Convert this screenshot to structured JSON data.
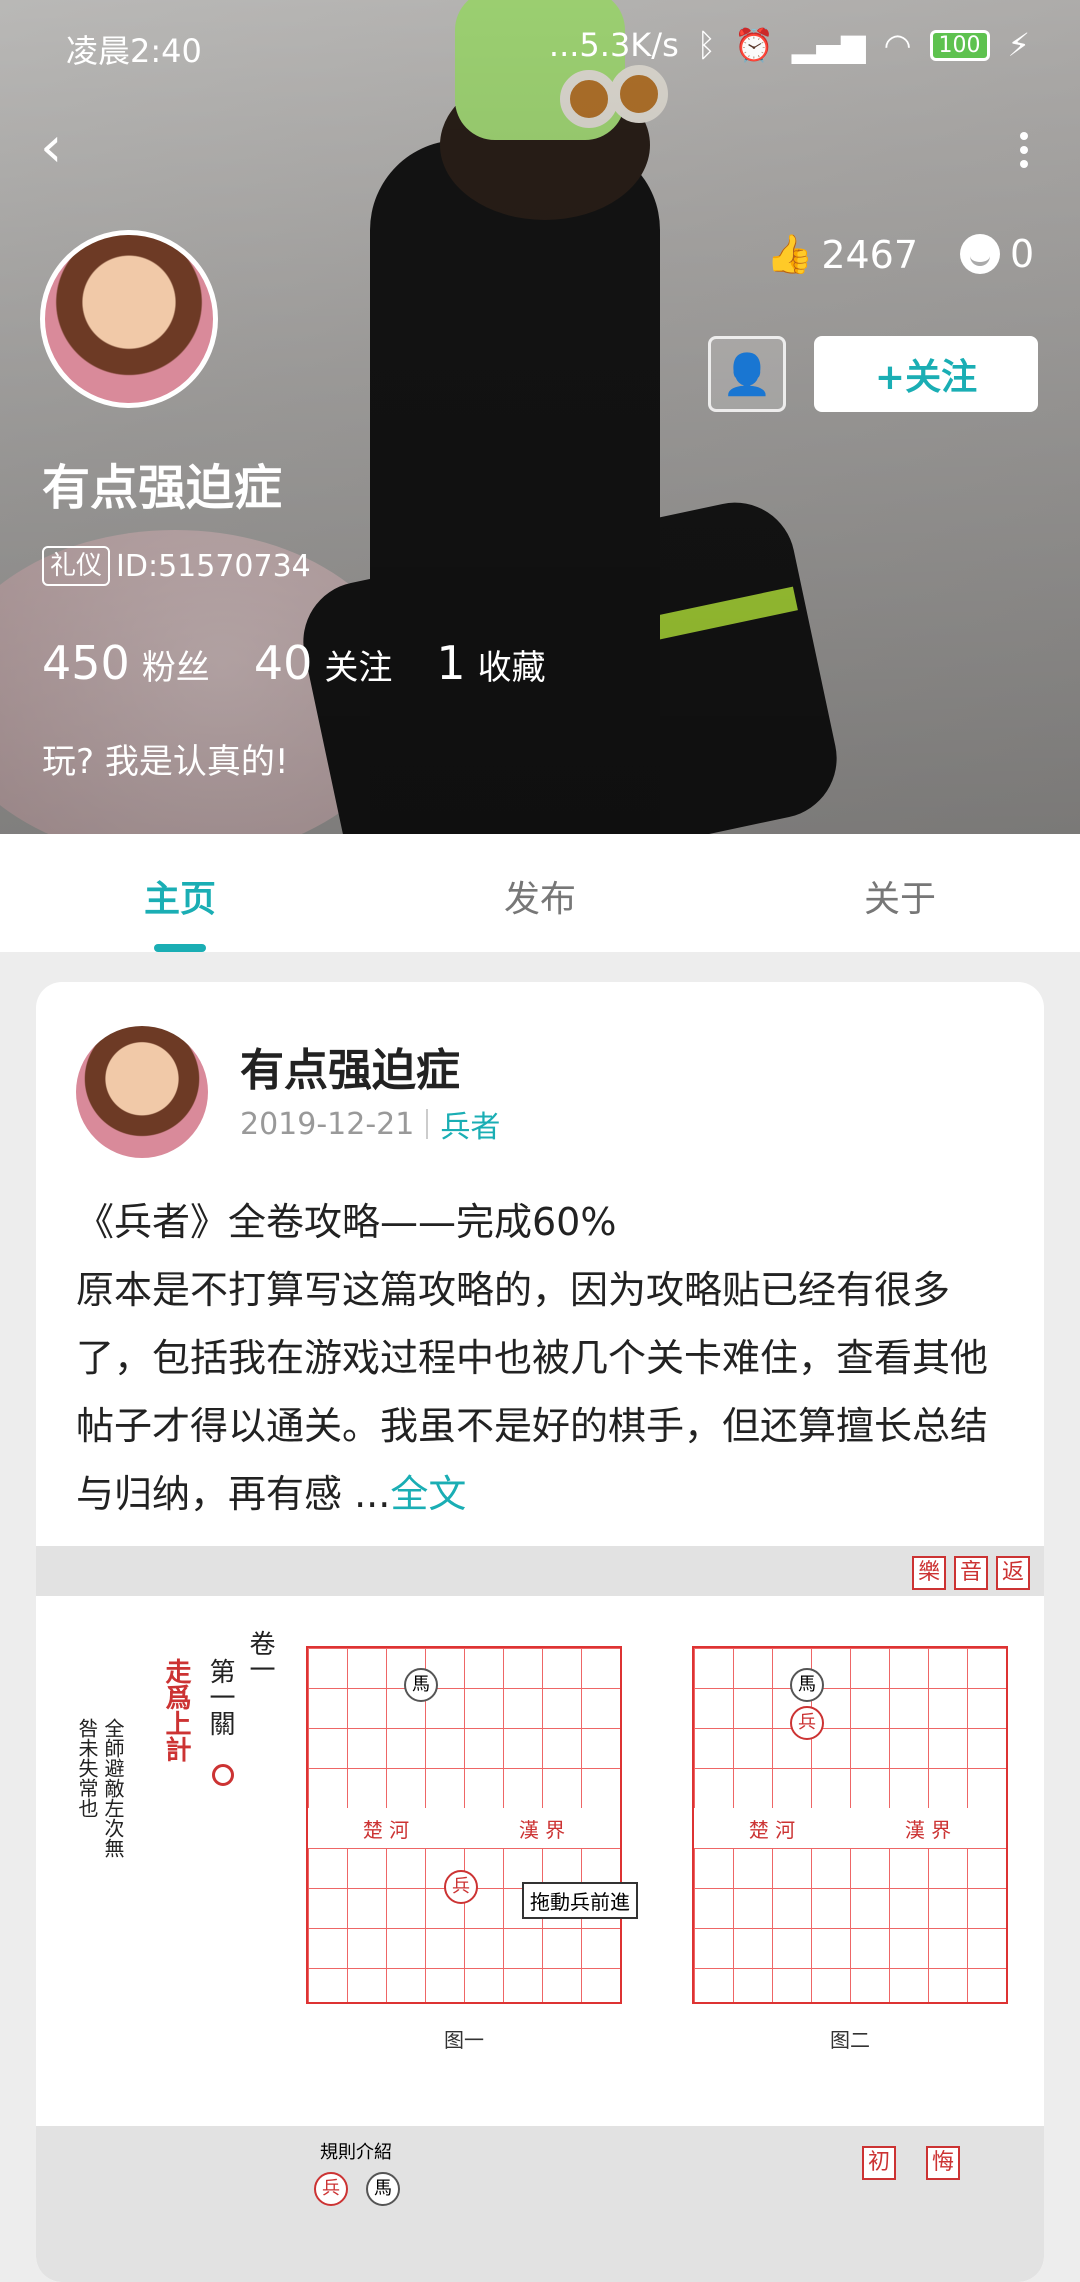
{
  "status_bar": {
    "time": "凌晨2:40",
    "network_speed": "...5.3K/s",
    "battery": "100"
  },
  "profile": {
    "likes": "2467",
    "comments": "0",
    "follow_label": "+关注",
    "username": "有点强迫症",
    "tag": "礼仪",
    "id_text": "ID:51570734",
    "stats": [
      {
        "num": "450",
        "label": "粉丝"
      },
      {
        "num": "40",
        "label": "关注"
      },
      {
        "num": "1",
        "label": "收藏"
      }
    ],
    "bio": "玩? 我是认真的!"
  },
  "tabs": [
    {
      "label": "主页"
    },
    {
      "label": "发布"
    },
    {
      "label": "关于"
    }
  ],
  "post": {
    "author": "有点强迫症",
    "date": "2019-12-21",
    "category": "兵者",
    "title": "《兵者》全卷攻略——完成60%",
    "body": "原本是不打算写这篇攻略的，因为攻略贴已经有很多了，包括我在游戏过程中也被几个关卡难住，查看其他帖子才得以通关。我虽不是好的棋手，但还算擅长总结与归纳，再有感 ...",
    "read_more": "全文",
    "game": {
      "seals_top": [
        "樂",
        "音",
        "返"
      ],
      "volume": "卷一",
      "level": "第一關",
      "title_red": "走爲上計",
      "rule": "全師避敵左次無咎未失常也",
      "drag_hint": "拖動兵前進",
      "fig1": "图一",
      "fig2": "图二",
      "rules_intro": "規則介紹",
      "piece_bing": "兵",
      "piece_ma": "馬",
      "river_left": "楚  河",
      "river_right": "漢  界",
      "seals_bottom": [
        "初",
        "悔"
      ]
    }
  }
}
